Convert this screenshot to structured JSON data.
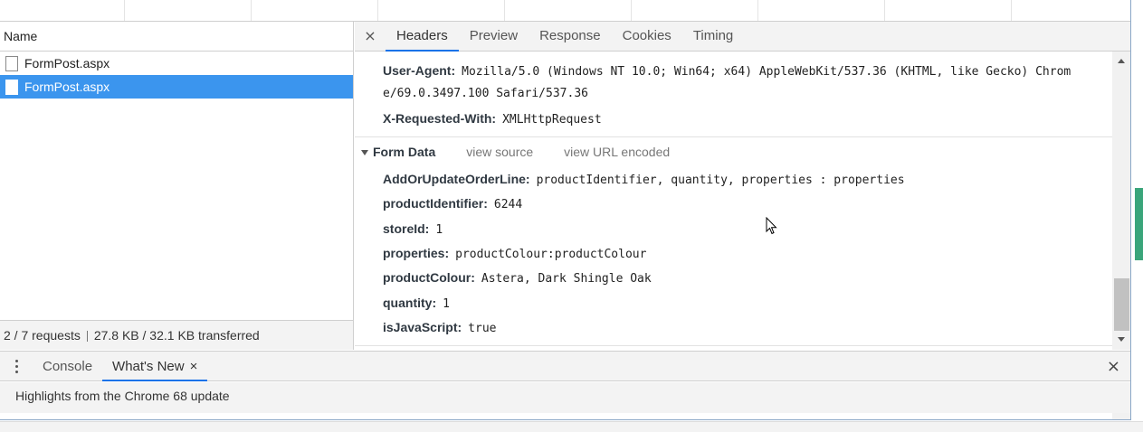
{
  "network": {
    "name_column": "Name",
    "requests": [
      {
        "name": "FormPost.aspx",
        "selected": false
      },
      {
        "name": "FormPost.aspx",
        "selected": true
      }
    ],
    "summary": {
      "requests": "2 / 7 requests",
      "transferred": "27.8 KB / 32.1 KB transferred"
    }
  },
  "detail": {
    "close_icon": "×",
    "tabs": [
      "Headers",
      "Preview",
      "Response",
      "Cookies",
      "Timing"
    ],
    "active_tab": "Headers",
    "request_headers": [
      {
        "key": "User-Agent:",
        "value": "Mozilla/5.0 (Windows NT 10.0; Win64; x64) AppleWebKit/537.36 (KHTML, like Gecko) Chrom",
        "value_cont": "e/69.0.3497.100 Safari/537.36"
      },
      {
        "key": "X-Requested-With:",
        "value": "XMLHttpRequest"
      }
    ],
    "form_data": {
      "title": "Form Data",
      "view_source": "view source",
      "view_url_encoded": "view URL encoded",
      "fields": [
        {
          "key": "AddOrUpdateOrderLine:",
          "value": "productIdentifier, quantity, properties : properties"
        },
        {
          "key": "productIdentifier:",
          "value": "6244"
        },
        {
          "key": "storeId:",
          "value": "1"
        },
        {
          "key": "properties:",
          "value": "productColour:productColour"
        },
        {
          "key": "productColour:",
          "value": "Astera, Dark Shingle Oak"
        },
        {
          "key": "quantity:",
          "value": "1"
        },
        {
          "key": "isJavaScript:",
          "value": "true"
        }
      ]
    }
  },
  "drawer": {
    "tabs": [
      {
        "label": "Console",
        "active": false
      },
      {
        "label": "What's New",
        "active": true,
        "close": "×"
      }
    ],
    "close_icon": "×",
    "content": "Highlights from the Chrome 68 update"
  },
  "icons": {
    "file": "file-icon",
    "menu": "kebab-menu-icon",
    "cursor": "mouse-pointer-icon"
  },
  "colors": {
    "selection": "#3b95ee",
    "active_tab_underline": "#1a73e8",
    "side_accent": "#3aa57a"
  }
}
